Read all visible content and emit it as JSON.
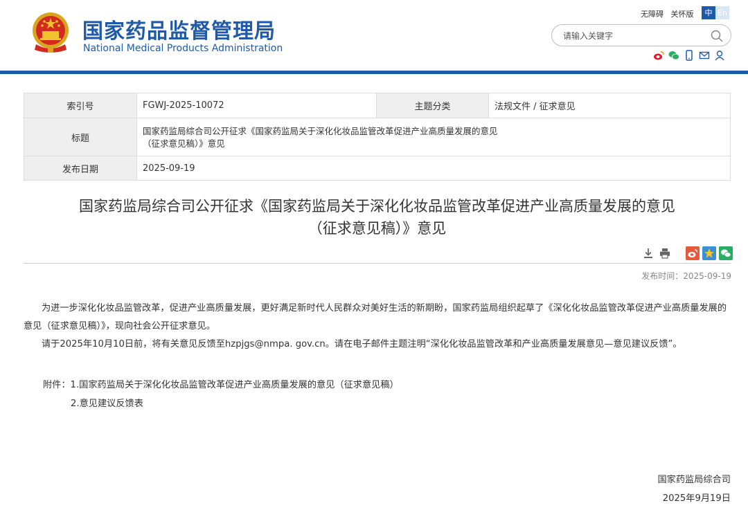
{
  "header": {
    "title_cn": "国家药品监督管理局",
    "title_en": "National Medical Products Administration",
    "links": [
      "无障碍",
      "关怀版"
    ],
    "lang_zh": "中",
    "lang_en": "En",
    "search_placeholder": "请输入关键字",
    "brand_color": "#1f5aa8"
  },
  "info": {
    "index_label": "索引号",
    "index_value": "FGWJ-2025-10072",
    "category_label": "主题分类",
    "category_value": "法规文件 / 征求意见",
    "title_label": "标题",
    "title_value_line1": "国家药监局综合司公开征求《国家药监局关于深化化妆品监管改革促进产业高质量发展的意见",
    "title_value_line2": "（征求意见稿）》意见",
    "date_label": "发布日期",
    "date_value": "2025-09-19"
  },
  "article": {
    "title_line1": "国家药监局综合司公开征求《国家药监局关于深化化妆品监管改革促进产业高质量发展的意见",
    "title_line2": "（征求意见稿）》意见",
    "pub_time": "发布时间：2025-09-19",
    "para1": "为进一步深化化妆品监管改革，促进产业高质量发展，更好满足新时代人民群众对美好生活的新期盼，国家药监局组织起草了《深化化妆品监管改革促进产业高质量发展的意见（征求意见稿）》，现向社会公开征求意见。",
    "para2": "请于2025年10月10日前，将有关意见反馈至hzpjgs@nmpa. gov.cn。请在电子邮件主题注明“深化化妆品监管改革和产业高质量发展意见—意见建议反馈”。",
    "attach1": "附件：1.国家药监局关于深化化妆品监管改革促进产业高质量发展的意见（征求意见稿）",
    "attach2": "2.意见建议反馈表",
    "sign_org": "国家药监局综合司",
    "sign_date": "2025年9月19日"
  }
}
